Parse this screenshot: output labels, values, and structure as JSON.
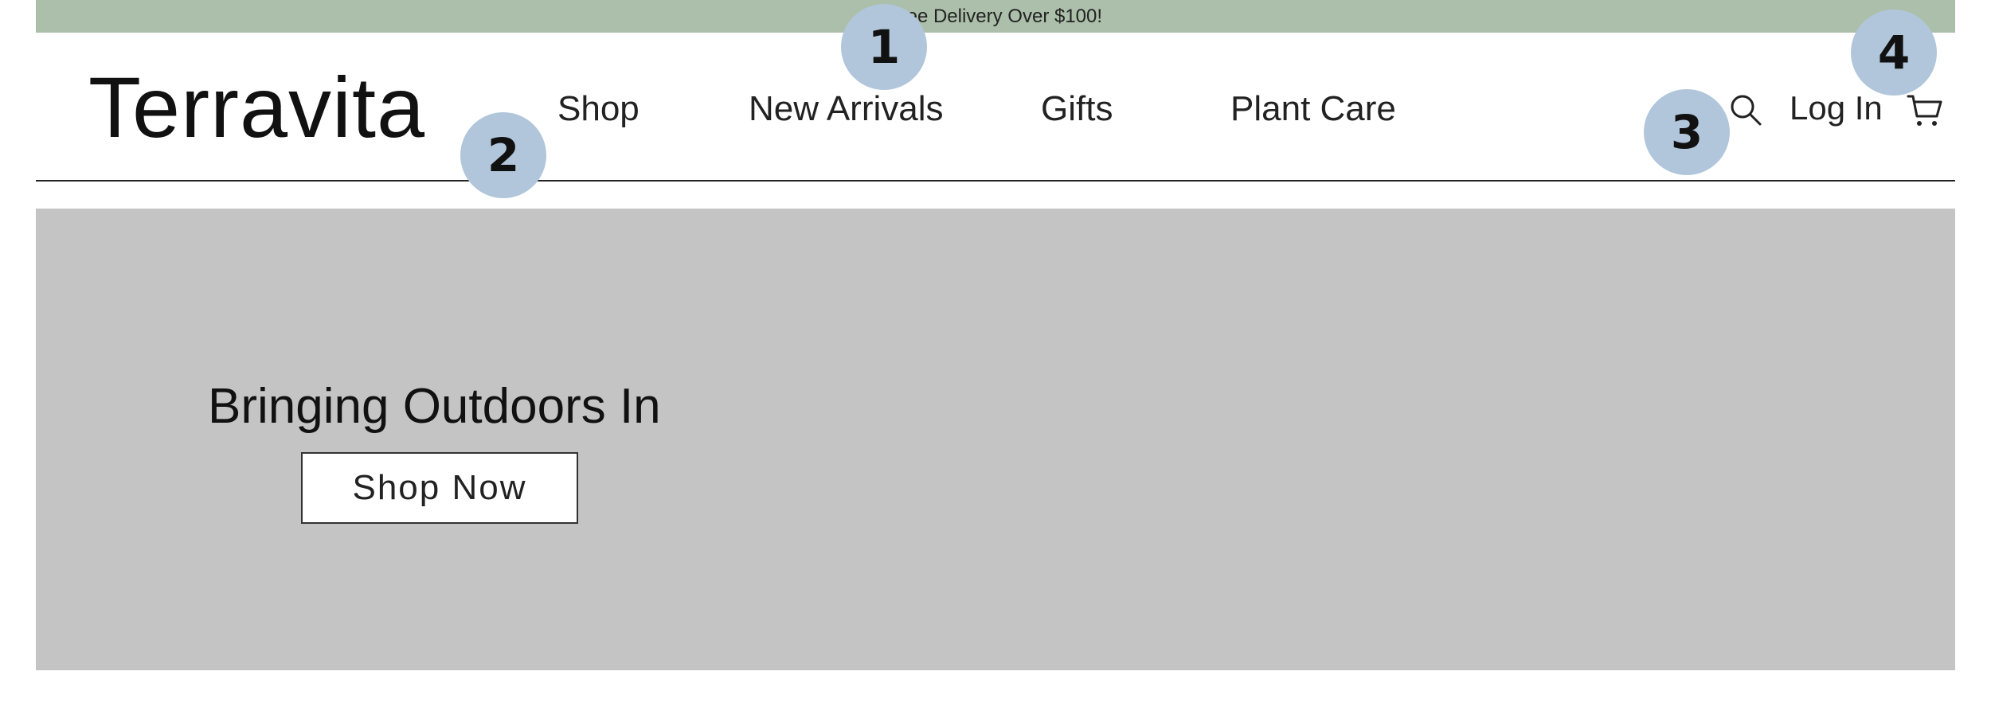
{
  "promo": {
    "text": "Free Delivery Over $100!"
  },
  "brand": {
    "name": "Terravita"
  },
  "nav": {
    "items": [
      {
        "label": "Shop"
      },
      {
        "label": "New Arrivals"
      },
      {
        "label": "Gifts"
      },
      {
        "label": "Plant Care"
      }
    ]
  },
  "header_actions": {
    "search_icon": "search-icon",
    "login_label": "Log In",
    "cart_icon": "cart-icon"
  },
  "hero": {
    "title": "Bringing Outdoors In",
    "button_label": "Shop Now"
  },
  "markers": [
    "1",
    "2",
    "3",
    "4"
  ],
  "colors": {
    "promo_background": "#abbfaa",
    "hero_background": "#c4c4c4",
    "marker_background": "#b1c6da"
  }
}
